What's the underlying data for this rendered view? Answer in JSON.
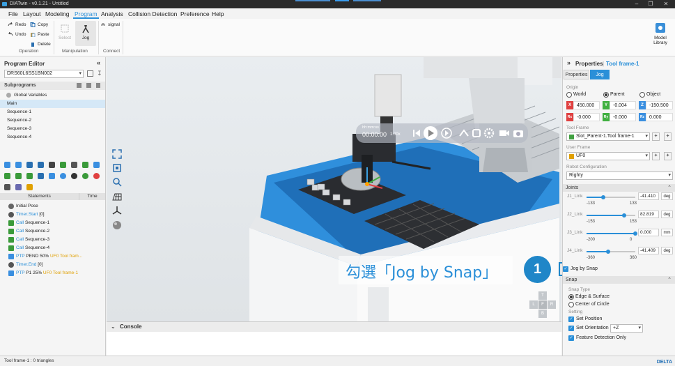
{
  "window": {
    "title": "DIATwin - v0.1.21 - Untitled"
  },
  "menu": [
    "File",
    "Layout",
    "Modeling",
    "Program",
    "Analysis",
    "Collision Detection",
    "Preference",
    "Help"
  ],
  "ribbon": {
    "redo": "Redo",
    "undo": "Undo",
    "copy": "Copy",
    "paste": "Paste",
    "delete": "Delete",
    "operation": "Operation",
    "select": "Select",
    "jog": "Jog",
    "manipulation": "Manipulation",
    "signal": "signal",
    "connect": "Connect",
    "model_library": "Model Library"
  },
  "program_editor": {
    "title": "Program Editor",
    "robot": "DRS60L6SS1BN002",
    "subprograms_title": "Subprograms",
    "subprograms": [
      "Global Variables",
      "Main",
      "Sequence-1",
      "Sequence-2",
      "Sequence-3",
      "Sequence-4"
    ],
    "col_statements": "Statements",
    "col_time": "Time",
    "statements": [
      {
        "a": "Initial Pose",
        "b": "",
        "c": "",
        "d": ""
      },
      {
        "a": "",
        "b": "Timer.Start",
        "c": " [0]",
        "d": ""
      },
      {
        "a": "",
        "b": "Call",
        "c": " Sequence-1",
        "d": ""
      },
      {
        "a": "",
        "b": "Call",
        "c": " Sequence-2",
        "d": ""
      },
      {
        "a": "",
        "b": "Call",
        "c": " Sequence-3",
        "d": ""
      },
      {
        "a": "",
        "b": "Call",
        "c": " Sequence-4",
        "d": ""
      },
      {
        "a": "",
        "b": "PTP",
        "c": " PEND 50% ",
        "d": "UF0",
        "e": " Tool fram..."
      },
      {
        "a": "",
        "b": "Timer.End",
        "c": " [0]",
        "d": ""
      },
      {
        "a": "",
        "b": "PTP",
        "c": " P1 25% ",
        "d": "UF0",
        "e": " Tool frame-1"
      }
    ]
  },
  "playback": {
    "time_format": "hh:mm:ss",
    "time": "00:00:00",
    "speed": "1.00x"
  },
  "navcube": {
    "top": "T",
    "left": "L",
    "right": "R",
    "bottom": "B",
    "front": "F"
  },
  "callout": {
    "text": "勾選「Jog by Snap」",
    "number": "1"
  },
  "console": {
    "title": "Console"
  },
  "statusbar": {
    "text": "Tool frame-1 : 0 triangles",
    "brand": "DELTA"
  },
  "properties": {
    "title": "Properties",
    "subject": "Tool frame-1",
    "tabs": [
      "Properties",
      "Jog"
    ],
    "origin_label": "Origin",
    "origin_options": [
      "World",
      "Parent",
      "Object"
    ],
    "x": "450.000",
    "y": "-0.004",
    "z": "-150.500",
    "rx": "-0.000",
    "ry": "-0.000",
    "rz": "0.000",
    "rx_tag": "Rx",
    "ry_tag": "Ry",
    "rz_tag": "Rz",
    "tool_frame_label": "Tool Frame",
    "tool_frame": "Slot_Parent-1.Tool frame-1",
    "user_frame_label": "User Frame",
    "user_frame": "UF0",
    "robot_config_label": "Robot Configuration",
    "robot_config": "Righty",
    "joints_title": "Joints",
    "joints": [
      {
        "name": "J1_Link",
        "min": "-133",
        "max": "133",
        "value": "-41.410",
        "unit": "deg",
        "frac": 0.344
      },
      {
        "name": "J2_Link",
        "min": "-153",
        "max": "153",
        "value": "82.819",
        "unit": "deg",
        "frac": 0.77
      },
      {
        "name": "J3_Link",
        "min": "-200",
        "max": "0",
        "value": "0.000",
        "unit": "mm",
        "frac": 1.0
      },
      {
        "name": "J4_Link",
        "min": "-360",
        "max": "360",
        "value": "-41.409",
        "unit": "deg",
        "frac": 0.442
      }
    ],
    "jog_by_snap": "Jog by Snap",
    "snap_title": "Snap",
    "snap_type_label": "Snap Type",
    "snap_types": [
      "Edge & Surface",
      "Center of Circle"
    ],
    "setting_label": "Setting",
    "set_position": "Set Position",
    "set_orientation": "Set Orientation",
    "orientation_axis": "+Z",
    "feature_detection": "Feature Detection Only"
  },
  "colors": {
    "accent": "#2a8fd8",
    "x_axis": "#e04040",
    "y_axis": "#40b040",
    "z_axis": "#3a8fe0"
  }
}
